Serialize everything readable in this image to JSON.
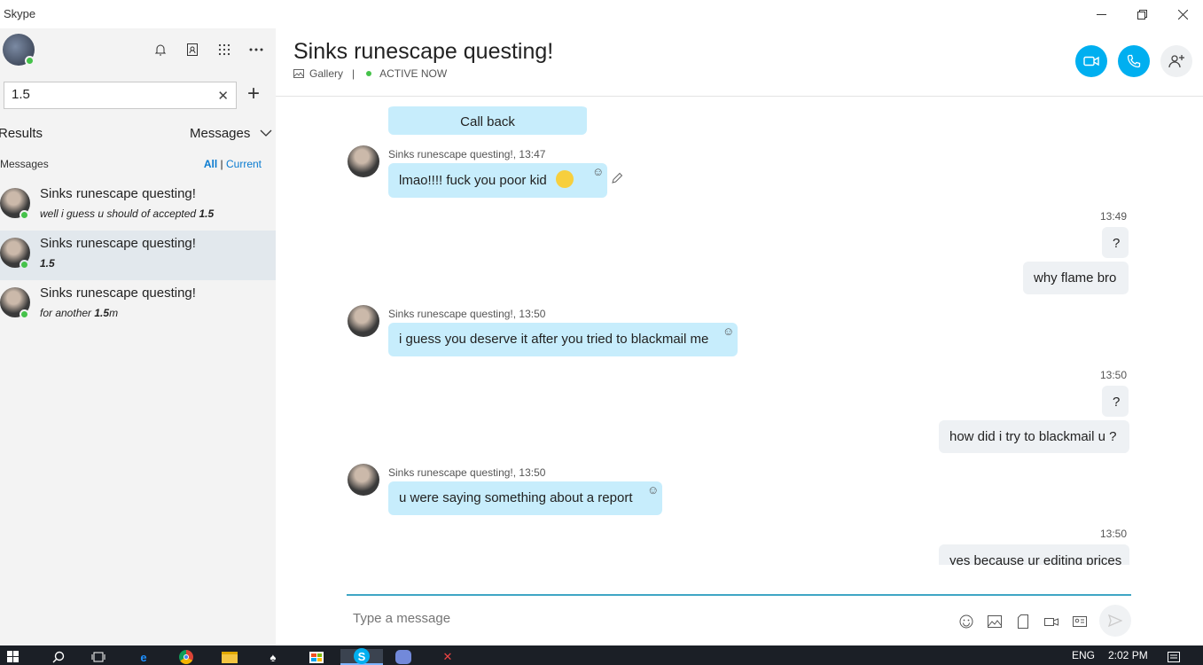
{
  "app": {
    "title": "Skype"
  },
  "window": {
    "minimize_icon": "minimize-icon",
    "maximize_icon": "restore-icon",
    "close_icon": "close-icon"
  },
  "sidebar": {
    "search": {
      "value": "1.5"
    },
    "results_label": "Results",
    "messages_dropdown": "Messages",
    "messages_section": "Messages",
    "filter_all": "All",
    "filter_sep": "|",
    "filter_current": "Current",
    "results": [
      {
        "name": "Sinks runescape questing!",
        "snippet_pre": "well i guess u should of accepted ",
        "snippet_bold": "1.5",
        "snippet_post": ""
      },
      {
        "name": "Sinks runescape questing!",
        "snippet_pre": "",
        "snippet_bold": "1.5",
        "snippet_post": ""
      },
      {
        "name": "Sinks runescape questing!",
        "snippet_pre": "for another ",
        "snippet_bold": "1.5",
        "snippet_post": "m"
      }
    ]
  },
  "header": {
    "title": "Sinks runescape questing!",
    "gallery": "Gallery",
    "separator": "|",
    "status": "ACTIVE NOW"
  },
  "chat": {
    "call_back": "Call back",
    "messages": [
      {
        "sender": "Sinks runescape questing!, 13:47",
        "text": "lmao!!!! fuck you poor kid"
      },
      {
        "time": "13:49",
        "text1": "?",
        "text2": "why flame bro"
      },
      {
        "sender": "Sinks runescape questing!, 13:50",
        "text": "i guess you deserve it after you tried to blackmail me"
      },
      {
        "time": "13:50",
        "text1": "?",
        "text2": "how did i try to blackmail u ?"
      },
      {
        "sender": "Sinks runescape questing!, 13:50",
        "text": "u were saying something about a report"
      },
      {
        "time": "13:50",
        "text1": "yes because ur editing prices"
      }
    ]
  },
  "composer": {
    "placeholder": "Type a message"
  },
  "taskbar": {
    "lang": "ENG",
    "clock": "2:02 PM"
  },
  "colors": {
    "accent": "#00aff0",
    "bubble_in": "#c7edfc",
    "bubble_out": "#eef1f4",
    "online": "#45c24a"
  }
}
